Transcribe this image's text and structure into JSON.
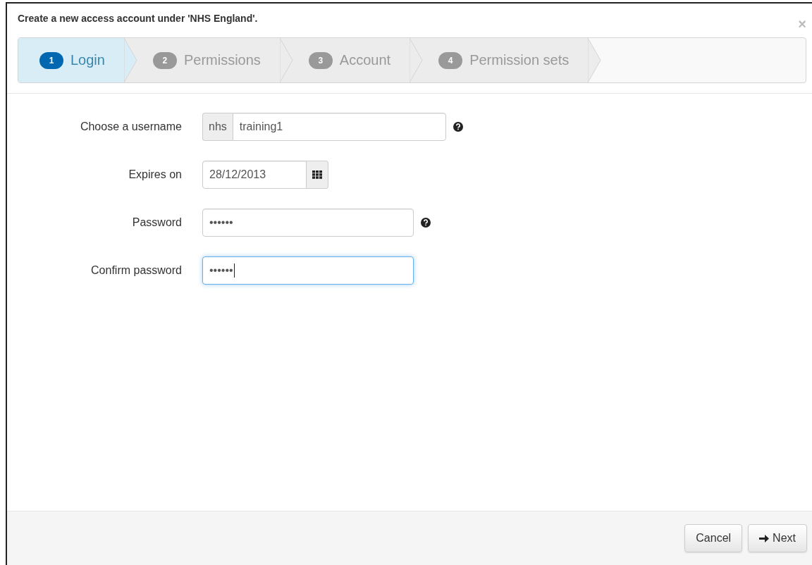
{
  "dialog": {
    "title": "Create a new access account under 'NHS England'.",
    "close": "×"
  },
  "steps": [
    {
      "number": "1",
      "label": "Login",
      "selected": true
    },
    {
      "number": "2",
      "label": "Permissions",
      "selected": false
    },
    {
      "number": "3",
      "label": "Account",
      "selected": false
    },
    {
      "number": "4",
      "label": "Permission sets",
      "selected": false
    }
  ],
  "fields": [
    {
      "kind": "prefix",
      "label": "Choose a username",
      "prefix": "nhs",
      "value": "training1",
      "help": true,
      "focused": false
    },
    {
      "kind": "date",
      "label": "Expires on",
      "value": "28/12/2013",
      "help": false,
      "focused": false
    },
    {
      "kind": "password",
      "label": "Password",
      "value": "••••••",
      "help": true,
      "focused": false
    },
    {
      "kind": "password",
      "label": "Confirm password",
      "value": "••••••",
      "help": false,
      "focused": true
    }
  ],
  "buttons": [
    {
      "kind": "cancel",
      "label": "Cancel"
    },
    {
      "kind": "next",
      "label": "Next"
    }
  ]
}
